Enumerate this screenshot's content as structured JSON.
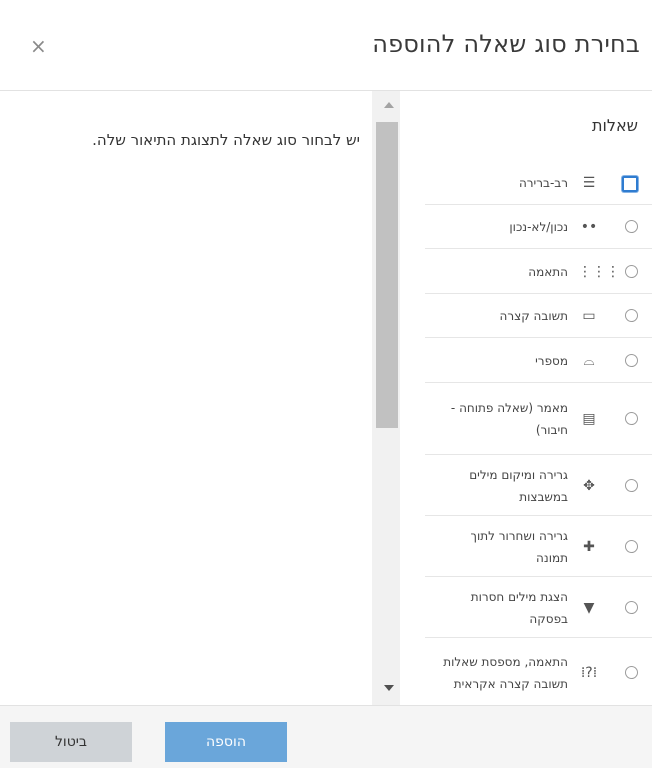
{
  "dialog": {
    "title": "בחירת סוג שאלה להוספה",
    "close_glyph": "×"
  },
  "description": "יש לבחור סוג שאלה לתצוגת התיאור שלה.",
  "section_label": "שאלות",
  "options": [
    {
      "label": "רב-ברירה",
      "icon": "list-icon",
      "glyph": "☰",
      "selected": true
    },
    {
      "label": "נכון/לא-נכון",
      "icon": "two-dots-icon",
      "glyph": "••",
      "selected": false
    },
    {
      "label": "התאמה",
      "icon": "grid-dots-icon",
      "glyph": "⋮⋮⋮",
      "selected": false
    },
    {
      "label": "תשובה קצרה",
      "icon": "short-answer-icon",
      "glyph": "▭",
      "selected": false
    },
    {
      "label": "מספרי",
      "icon": "numerical-icon",
      "glyph": "⌓",
      "selected": false
    },
    {
      "label": "מאמר (שאלה פתוחה - חיבור)",
      "icon": "essay-icon",
      "glyph": "▤",
      "selected": false
    },
    {
      "label": "גרירה ומיקום מילים במשבצות",
      "icon": "drag-words-icon",
      "glyph": "✥",
      "selected": false
    },
    {
      "label": "גרירה ושחרור לתוך תמונה",
      "icon": "drag-image-icon",
      "glyph": "✚",
      "selected": false
    },
    {
      "label": "הצגת מילים חסרות בפסקה",
      "icon": "dropdown-icon",
      "glyph": "▼",
      "selected": false
    },
    {
      "label": "התאמה, מספסת שאלות תשובה קצרה אקראית",
      "icon": "random-match-icon",
      "glyph": "⁞?⁞",
      "selected": false
    }
  ],
  "footer": {
    "add_label": "הוספה",
    "cancel_label": "ביטול"
  }
}
